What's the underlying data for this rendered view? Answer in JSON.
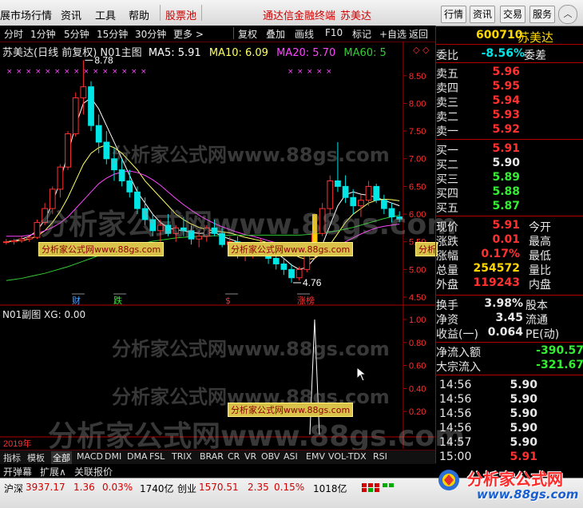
{
  "menu": {
    "items": [
      "展市场行情",
      "资讯",
      "工具",
      "帮助",
      "股票池"
    ],
    "center_title": "通达信金融终端",
    "center_stock": "苏美达",
    "right_buttons": [
      "行情",
      "资讯",
      "交易",
      "服务"
    ]
  },
  "toolbar": {
    "left": [
      "分时",
      "1分钟",
      "5分钟",
      "15分钟",
      "30分钟",
      "更多 >"
    ],
    "right": [
      "复权",
      "叠加",
      "画线",
      "F10",
      "标记",
      "+自选",
      "返回"
    ]
  },
  "main_chart": {
    "title": "苏美达(日线 前复权) N01主图",
    "ma5_label": "MA5:",
    "ma5": "5.91",
    "ma10_label": "MA10:",
    "ma10": "6.09",
    "ma20_label": "MA20:",
    "ma20": "5.70",
    "ma60_label": "MA60:",
    "ma60_tail": "5",
    "high_label": "8.78",
    "low_label": "4.76",
    "y_ticks": [
      "8.50",
      "8.00",
      "7.50",
      "7.00",
      "6.50",
      "6.00",
      "5.50",
      "5.00",
      "4.50"
    ],
    "markers": [
      "财",
      "跌",
      "$",
      "涨榜"
    ]
  },
  "sub_chart": {
    "title": "N01副图 XG: 0.00",
    "y_ticks": [
      "1.00",
      "0.80",
      "0.60",
      "0.40",
      "0.20"
    ],
    "year_label": "2019年"
  },
  "watermarks": {
    "big": "分析家公式网www.88gs.com",
    "small": "分析家公式网www.88gs.com"
  },
  "chart_data": {
    "type": "candlestick",
    "ylim": [
      4.5,
      8.8
    ],
    "candles": [
      [
        5.5,
        5.55,
        5.45,
        5.5
      ],
      [
        5.5,
        5.55,
        5.45,
        5.52
      ],
      [
        5.52,
        5.6,
        5.48,
        5.55
      ],
      [
        5.55,
        5.6,
        5.5,
        5.58
      ],
      [
        5.58,
        5.9,
        5.55,
        5.85
      ],
      [
        5.85,
        6.2,
        5.8,
        6.1
      ],
      [
        6.1,
        6.5,
        6.0,
        6.45
      ],
      [
        6.45,
        6.9,
        6.3,
        6.85
      ],
      [
        6.85,
        7.5,
        6.8,
        7.45
      ],
      [
        7.45,
        8.2,
        7.4,
        8.1
      ],
      [
        8.1,
        8.78,
        7.8,
        8.3
      ],
      [
        8.3,
        8.4,
        7.5,
        7.6
      ],
      [
        7.6,
        7.8,
        7.1,
        7.3
      ],
      [
        7.3,
        7.5,
        6.9,
        7.0
      ],
      [
        7.0,
        7.2,
        6.6,
        6.8
      ],
      [
        6.8,
        7.0,
        6.5,
        6.6
      ],
      [
        6.6,
        6.8,
        6.3,
        6.4
      ],
      [
        6.4,
        6.5,
        6.0,
        6.1
      ],
      [
        6.1,
        6.3,
        5.8,
        5.9
      ],
      [
        5.9,
        6.0,
        5.6,
        5.7
      ],
      [
        5.7,
        5.9,
        5.5,
        5.8
      ],
      [
        5.8,
        6.0,
        5.6,
        5.65
      ],
      [
        5.65,
        5.8,
        5.5,
        5.75
      ],
      [
        5.75,
        5.95,
        5.6,
        5.7
      ],
      [
        5.7,
        5.8,
        5.45,
        5.55
      ],
      [
        5.55,
        5.7,
        5.4,
        5.6
      ],
      [
        5.6,
        5.8,
        5.5,
        5.75
      ],
      [
        5.75,
        5.9,
        5.6,
        5.65
      ],
      [
        5.65,
        5.75,
        5.4,
        5.45
      ],
      [
        5.45,
        5.6,
        5.3,
        5.5
      ],
      [
        5.5,
        5.6,
        5.2,
        5.3
      ],
      [
        5.3,
        5.45,
        5.15,
        5.35
      ],
      [
        5.35,
        5.5,
        5.2,
        5.4
      ],
      [
        5.4,
        5.55,
        5.3,
        5.45
      ],
      [
        5.45,
        5.5,
        5.1,
        5.2
      ],
      [
        5.2,
        5.3,
        5.0,
        5.1
      ],
      [
        5.1,
        5.2,
        4.9,
        5.0
      ],
      [
        5.0,
        5.1,
        4.76,
        4.85
      ],
      [
        4.85,
        5.05,
        4.8,
        5.0
      ],
      [
        5.0,
        5.3,
        4.95,
        5.25
      ],
      [
        5.25,
        5.7,
        5.2,
        5.65
      ],
      [
        5.65,
        6.2,
        5.6,
        6.1
      ],
      [
        6.1,
        6.7,
        6.0,
        6.6
      ],
      [
        6.6,
        7.3,
        6.4,
        6.5
      ],
      [
        6.5,
        6.7,
        6.2,
        6.3
      ],
      [
        6.3,
        6.45,
        6.0,
        6.15
      ],
      [
        6.15,
        6.35,
        5.95,
        6.25
      ],
      [
        6.25,
        6.6,
        6.15,
        6.5
      ],
      [
        6.5,
        6.55,
        6.2,
        6.25
      ],
      [
        6.25,
        6.35,
        6.0,
        6.1
      ],
      [
        6.1,
        6.2,
        5.85,
        5.95
      ],
      [
        5.95,
        6.05,
        5.85,
        5.91
      ]
    ],
    "series": [
      {
        "name": "MA5",
        "values": [
          5.5,
          5.52,
          5.55,
          5.6,
          5.7,
          5.9,
          6.2,
          6.6,
          7.1,
          7.6,
          8.0,
          8.1,
          7.9,
          7.6,
          7.3,
          7.0,
          6.7,
          6.4,
          6.2,
          6.0,
          5.85,
          5.75,
          5.72,
          5.7,
          5.67,
          5.65,
          5.66,
          5.67,
          5.6,
          5.55,
          5.5,
          5.45,
          5.42,
          5.4,
          5.37,
          5.3,
          5.2,
          5.08,
          5.0,
          5.04,
          5.2,
          5.45,
          5.8,
          6.15,
          6.35,
          6.4,
          6.36,
          6.34,
          6.3,
          6.25,
          6.2,
          6.15
        ]
      },
      {
        "name": "MA10",
        "values": [
          5.5,
          5.51,
          5.52,
          5.55,
          5.6,
          5.7,
          5.85,
          6.05,
          6.3,
          6.6,
          6.9,
          7.1,
          7.2,
          7.25,
          7.2,
          7.1,
          6.95,
          6.8,
          6.6,
          6.45,
          6.3,
          6.15,
          6.0,
          5.9,
          5.82,
          5.76,
          5.72,
          5.7,
          5.68,
          5.66,
          5.62,
          5.58,
          5.55,
          5.52,
          5.48,
          5.43,
          5.38,
          5.3,
          5.22,
          5.18,
          5.2,
          5.3,
          5.45,
          5.65,
          5.85,
          6.0,
          6.1,
          6.2,
          6.25,
          6.27,
          6.26,
          6.24
        ]
      },
      {
        "name": "MA20",
        "values": [
          5.6,
          5.6,
          5.6,
          5.62,
          5.65,
          5.7,
          5.76,
          5.84,
          5.95,
          6.1,
          6.25,
          6.4,
          6.55,
          6.65,
          6.72,
          6.76,
          6.78,
          6.75,
          6.7,
          6.62,
          6.52,
          6.4,
          6.28,
          6.17,
          6.07,
          5.98,
          5.9,
          5.83,
          5.77,
          5.72,
          5.67,
          5.63,
          5.6,
          5.56,
          5.52,
          5.48,
          5.44,
          5.4,
          5.37,
          5.34,
          5.32,
          5.33,
          5.37,
          5.43,
          5.5,
          5.57,
          5.64,
          5.7,
          5.75,
          5.78,
          5.8,
          5.82
        ]
      },
      {
        "name": "MA60",
        "values": [
          4.8,
          4.82,
          4.84,
          4.87,
          4.9,
          4.93,
          4.97,
          5.01,
          5.05,
          5.1,
          5.15,
          5.2,
          5.25,
          5.3,
          5.34,
          5.38,
          5.42,
          5.45,
          5.48,
          5.51,
          5.53,
          5.55,
          5.57,
          5.58,
          5.59,
          5.6,
          5.6,
          5.61,
          5.61,
          5.62,
          5.62,
          5.62,
          5.62,
          5.62,
          5.62,
          5.62,
          5.62,
          5.62,
          5.62,
          5.63,
          5.64,
          5.66,
          5.68,
          5.7,
          5.73,
          5.76,
          5.8,
          5.84,
          5.88,
          5.92,
          5.95,
          5.98
        ]
      }
    ],
    "xg_signal_index": 40
  },
  "quote": {
    "code": "600710",
    "name": "苏美达",
    "weibi_label": "委比",
    "weibi": "-8.56%",
    "weicha_label": "委差",
    "sells": [
      {
        "label": "卖五",
        "price": "5.96"
      },
      {
        "label": "卖四",
        "price": "5.95"
      },
      {
        "label": "卖三",
        "price": "5.94"
      },
      {
        "label": "卖二",
        "price": "5.93"
      },
      {
        "label": "卖一",
        "price": "5.92"
      }
    ],
    "buys": [
      {
        "label": "买一",
        "price": "5.91"
      },
      {
        "label": "买二",
        "price": "5.90"
      },
      {
        "label": "买三",
        "price": "5.89"
      },
      {
        "label": "买四",
        "price": "5.88"
      },
      {
        "label": "买五",
        "price": "5.87"
      }
    ],
    "stats": [
      {
        "l": "现价",
        "v": "5.91",
        "r": "今开",
        "c": "#ff3030"
      },
      {
        "l": "涨跌",
        "v": "0.01",
        "r": "最高",
        "c": "#ff3030"
      },
      {
        "l": "涨幅",
        "v": "0.17%",
        "r": "最低",
        "c": "#ff3030"
      },
      {
        "l": "总量",
        "v": "254572",
        "r": "量比",
        "c": "#ffd700"
      },
      {
        "l": "外盘",
        "v": "119243",
        "r": "内盘",
        "c": "#ff3030"
      }
    ],
    "stats2": [
      {
        "l": "换手",
        "v": "3.98%",
        "r": "股本",
        "c": "#e8e8e8"
      },
      {
        "l": "净资",
        "v": "3.45",
        "r": "流通",
        "c": "#e8e8e8"
      },
      {
        "l": "收益(一)",
        "v": "0.064",
        "r": "PE(动)",
        "c": "#e8e8e8"
      }
    ],
    "flows": [
      {
        "l": "净流入额",
        "v": "-390.57"
      },
      {
        "l": "大宗流入",
        "v": "-321.67"
      }
    ],
    "ticks": [
      {
        "t": "14:56",
        "p": "5.90",
        "c": "#e8e8e8"
      },
      {
        "t": "14:56",
        "p": "5.90",
        "c": "#e8e8e8"
      },
      {
        "t": "14:56",
        "p": "5.90",
        "c": "#e8e8e8"
      },
      {
        "t": "14:56",
        "p": "5.90",
        "c": "#e8e8e8"
      },
      {
        "t": "14:57",
        "p": "5.90",
        "c": "#e8e8e8"
      },
      {
        "t": "15:00",
        "p": "5.91",
        "c": "#ff3030"
      }
    ]
  },
  "tabs": {
    "left": [
      "指标",
      "模板",
      "全部"
    ],
    "indicators": [
      "MACD",
      "DMI",
      "DMA",
      "FSL",
      "TRIX",
      "BRAR",
      "CR",
      "VR",
      "OBV",
      "ASI",
      "EMV",
      "VOL-TDX",
      "RSI"
    ],
    "sub": [
      "开弹幕",
      "扩展∧",
      "关联报价"
    ]
  },
  "status": {
    "sh_label": "沪深",
    "sh_value": "3937.17",
    "sh_change": "1.36",
    "sh_pct": "0.03%",
    "sh_amount": "1740亿",
    "cy_label": "创业",
    "cy_value": "1570.51",
    "cy_change": "2.35",
    "cy_pct": "0.15%",
    "cy_amount": "1018亿"
  },
  "logo": {
    "line1": "分析家公式网",
    "line2": "www.88gs.com"
  },
  "colors": {
    "up": "#ff3030",
    "down": "#00e5e5",
    "ma5": "#ffffff",
    "ma10": "#ffff66",
    "ma20": "#ff44ff",
    "ma60": "#33cc33",
    "accent": "#ffd700"
  }
}
